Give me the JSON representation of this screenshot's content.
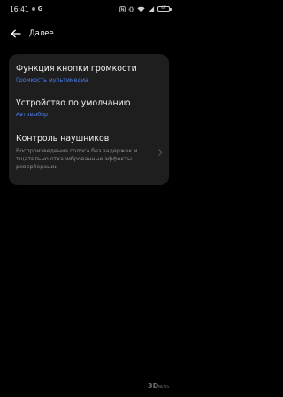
{
  "status_bar": {
    "time": "16:41",
    "g_label": "G",
    "battery_level": "47"
  },
  "header": {
    "title": "Далее",
    "back_icon": "arrow-left-icon"
  },
  "settings": {
    "items": [
      {
        "title": "Функция кнопки громкости",
        "subtitle": "Громкость мультимедиа"
      },
      {
        "title": "Устройство по умолчанию",
        "subtitle": "Автовыбор"
      },
      {
        "title": "Контроль наушников",
        "description": "Воспроизведение голоса без задержек и тщательно откалиброванные эффекты реверберации"
      }
    ]
  },
  "watermark": {
    "text_top": "3D",
    "text_bottom": "NEWS"
  },
  "colors": {
    "background": "#000000",
    "card": "#1e1e1e",
    "accent": "#4c7ef2",
    "secondary_text": "#8c8c8c"
  }
}
